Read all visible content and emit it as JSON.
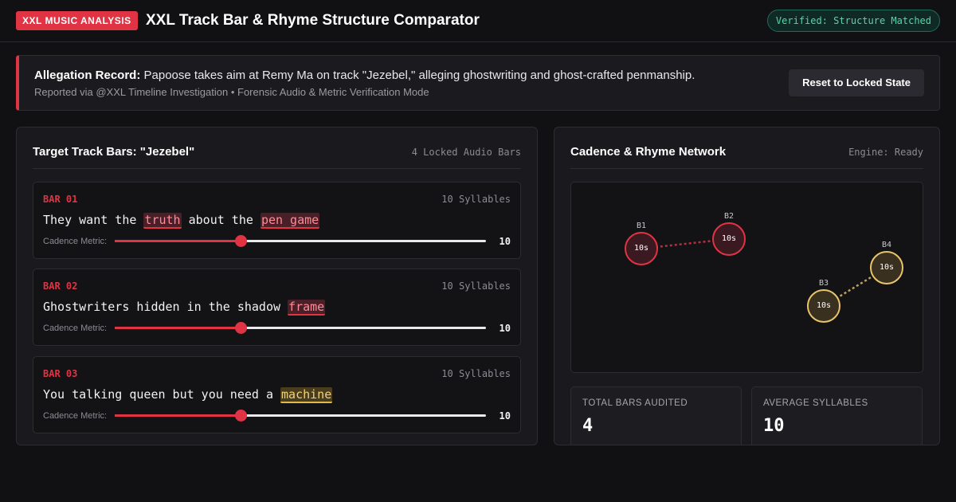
{
  "header": {
    "brand_badge": "XXL MUSIC ANALYSIS",
    "title": "XXL Track Bar & Rhyme Structure Comparator",
    "status_badge": "Verified: Structure Matched"
  },
  "banner": {
    "label": "Allegation Record:",
    "text": " Papoose takes aim at Remy Ma on track \"Jezebel,\" alleging ghostwriting and ghost-crafted penmanship.",
    "subtext": "Reported via @XXL Timeline Investigation • Forensic Audio & Metric Verification Mode",
    "reset_button": "Reset to Locked State"
  },
  "left_panel": {
    "title": "Target Track Bars: \"Jezebel\"",
    "meta": "4 Locked Audio Bars",
    "cadence_label": "Cadence Metric:",
    "bars": [
      {
        "label": "BAR 01",
        "syllables": "10 Syllables",
        "lyric": [
          {
            "text": "They want the ",
            "hl": ""
          },
          {
            "text": "truth",
            "hl": "red"
          },
          {
            "text": " about the ",
            "hl": ""
          },
          {
            "text": "pen game",
            "hl": "red"
          }
        ],
        "cadence": 10,
        "cadence_fraction": 0.34
      },
      {
        "label": "BAR 02",
        "syllables": "10 Syllables",
        "lyric": [
          {
            "text": "Ghostwriters hidden in the shadow ",
            "hl": ""
          },
          {
            "text": "frame",
            "hl": "red"
          }
        ],
        "cadence": 10,
        "cadence_fraction": 0.34
      },
      {
        "label": "BAR 03",
        "syllables": "10 Syllables",
        "lyric": [
          {
            "text": "You talking queen but you need a ",
            "hl": ""
          },
          {
            "text": "machine",
            "hl": "gold"
          }
        ],
        "cadence": 10,
        "cadence_fraction": 0.34
      }
    ]
  },
  "right_panel": {
    "title": "Cadence & Rhyme Network",
    "engine_status": "Engine: Ready",
    "nodes": [
      {
        "id": "B1",
        "value": "10s",
        "group": "red"
      },
      {
        "id": "B2",
        "value": "10s",
        "group": "red"
      },
      {
        "id": "B3",
        "value": "10s",
        "group": "gold"
      },
      {
        "id": "B4",
        "value": "10s",
        "group": "gold"
      }
    ],
    "links": [
      [
        "B1",
        "B2"
      ],
      [
        "B3",
        "B4"
      ]
    ],
    "stats": [
      {
        "label": "TOTAL BARS AUDITED",
        "value": "4"
      },
      {
        "label": "AVERAGE SYLLABLES",
        "value": "10"
      }
    ]
  },
  "colors": {
    "accent": "#e03444",
    "gold": "#e8c56a",
    "verified": "#55d6a7"
  }
}
